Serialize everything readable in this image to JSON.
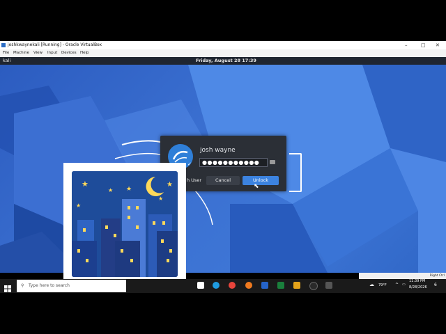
{
  "vbox": {
    "window_title": "joshkwaynekali [Running] - Oracle VirtualBox",
    "menu": [
      "File",
      "Machine",
      "View",
      "Input",
      "Devices",
      "Help"
    ],
    "controls": {
      "minimize": "–",
      "maximize": "□",
      "close": "✕"
    },
    "status_right": "Right Ctrl"
  },
  "kali": {
    "panel_left": "kali",
    "datetime": "Friday, August 28   17:39"
  },
  "lock": {
    "username": "josh wayne",
    "password_mask": "●●●●●●●●●●●",
    "buttons": {
      "switch_user": "h User",
      "cancel": "Cancel",
      "unlock": "Unlock"
    },
    "accent": "#3c83e0"
  },
  "emoji": {
    "name": "night-with-stars-icon"
  },
  "taskbar": {
    "search_placeholder": "Type here to search",
    "weather": "79°F",
    "time": "11:39 PM",
    "date": "8/28/2026",
    "notifications": "6"
  }
}
